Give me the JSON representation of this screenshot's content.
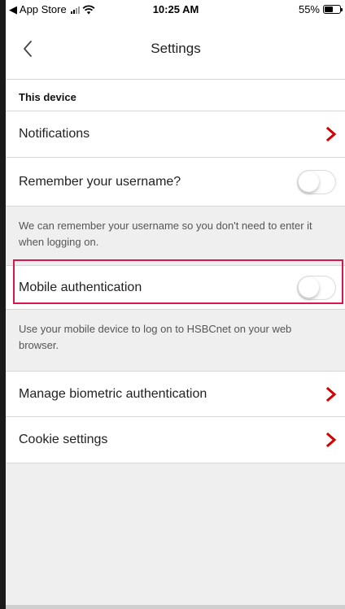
{
  "status_bar": {
    "back_app": "◀ App Store",
    "time": "10:25 AM",
    "battery": "55%",
    "battery_level": 0.55
  },
  "nav": {
    "title": "Settings",
    "back_icon": "chevron-left-icon"
  },
  "sections": {
    "this_device": "This device"
  },
  "rows": {
    "notifications": "Notifications",
    "remember_username": "Remember your username?",
    "remember_note": "We can remember your username so you don't need to enter it when logging on.",
    "mobile_auth": "Mobile authentication",
    "mobile_auth_note": "Use your mobile device to log on to HSBCnet on your web browser.",
    "biometric": "Manage biometric authentication",
    "cookie": "Cookie settings"
  },
  "toggles": {
    "remember_username_on": false,
    "mobile_auth_on": false
  },
  "colors": {
    "accent": "#d9174f",
    "chevron": "#d50000",
    "background": "#efefef"
  }
}
